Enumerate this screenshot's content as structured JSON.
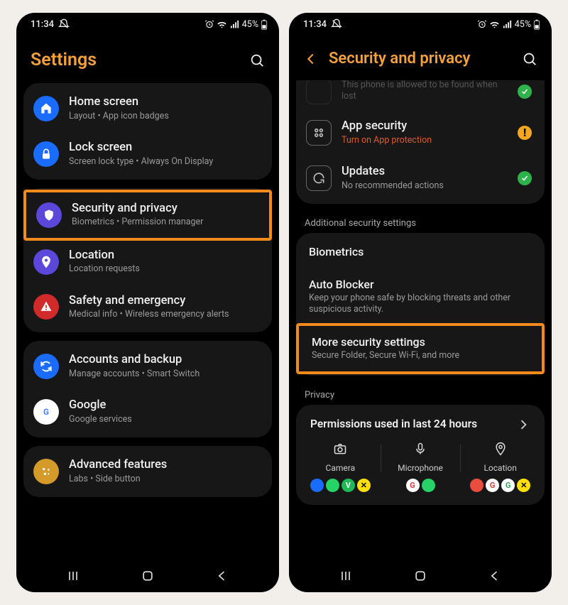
{
  "status": {
    "time": "11:34",
    "battery": "45%"
  },
  "left": {
    "title": "Settings",
    "groups": [
      {
        "items": [
          {
            "icon": "home",
            "color": "#1a6bff",
            "title": "Home screen",
            "sub": "Layout  •  App icon badges"
          },
          {
            "icon": "lock",
            "color": "#1a6bff",
            "title": "Lock screen",
            "sub": "Screen lock type  •  Always On Display"
          }
        ]
      },
      {
        "items": [
          {
            "icon": "shield",
            "color": "#5b47d9",
            "title": "Security and privacy",
            "sub": "Biometrics  •  Permission manager",
            "hl": true
          },
          {
            "icon": "pin",
            "color": "#5b47d9",
            "title": "Location",
            "sub": "Location requests"
          },
          {
            "icon": "alert",
            "color": "#d12a2a",
            "title": "Safety and emergency",
            "sub": "Medical info  •  Wireless emergency alerts"
          }
        ]
      },
      {
        "items": [
          {
            "icon": "sync",
            "color": "#1a6bff",
            "title": "Accounts and backup",
            "sub": "Manage accounts  •  Smart Switch"
          },
          {
            "icon": "google",
            "color": "#fff",
            "title": "Google",
            "sub": "Google services"
          }
        ]
      },
      {
        "items": [
          {
            "icon": "sparkle",
            "color": "#d49a2a",
            "title": "Advanced features",
            "sub": "Labs  •  Side button"
          }
        ]
      }
    ]
  },
  "right": {
    "title": "Security and privacy",
    "topClip": "This phone is allowed to be found when lost",
    "secCard": [
      {
        "icon": "grid",
        "title": "App security",
        "sub": "Turn on App protection",
        "warn": true,
        "dot": "warn"
      },
      {
        "icon": "refresh",
        "title": "Updates",
        "sub": "No recommended actions",
        "dot": "ok"
      }
    ],
    "addlLabel": "Additional security settings",
    "addl": [
      {
        "title": "Biometrics"
      },
      {
        "title": "Auto Blocker",
        "sub": "Keep your phone safe by blocking threats and other suspicious activity."
      },
      {
        "title": "More security settings",
        "sub": "Secure Folder, Secure Wi-Fi, and more",
        "hl": true
      }
    ],
    "privLabel": "Privacy",
    "permTitle": "Permissions used in last 24 hours",
    "perm": [
      {
        "label": "Camera",
        "icon": "camera",
        "apps": [
          {
            "bg": "#1a6bff",
            "fg": "#fff",
            "t": ""
          },
          {
            "bg": "#25d366",
            "fg": "#fff",
            "t": ""
          },
          {
            "bg": "#1db954",
            "fg": "#fff",
            "t": "V"
          },
          {
            "bg": "#ffe000",
            "fg": "#000",
            "t": "✕"
          }
        ]
      },
      {
        "label": "Microphone",
        "icon": "mic",
        "apps": [
          {
            "bg": "#fff",
            "fg": "#e33",
            "t": "G"
          },
          {
            "bg": "#25d366",
            "fg": "#fff",
            "t": ""
          }
        ]
      },
      {
        "label": "Location",
        "icon": "location",
        "apps": [
          {
            "bg": "#e84d3d",
            "fg": "#fff",
            "t": ""
          },
          {
            "bg": "#fff",
            "fg": "#e33",
            "t": "G"
          },
          {
            "bg": "#fff",
            "fg": "#34a853",
            "t": "G"
          },
          {
            "bg": "#ffe000",
            "fg": "#000",
            "t": "✕"
          }
        ]
      }
    ]
  }
}
